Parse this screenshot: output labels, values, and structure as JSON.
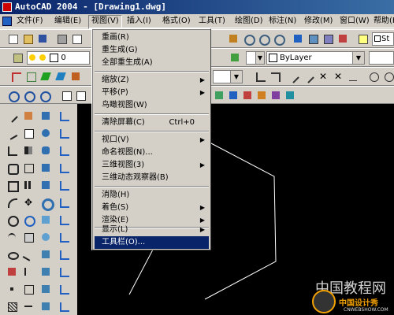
{
  "window": {
    "title": "AutoCAD 2004 - [Drawing1.dwg]"
  },
  "menubar": {
    "items": [
      {
        "label": "文件(F)"
      },
      {
        "label": "编辑(E)"
      },
      {
        "label": "视图(V)"
      },
      {
        "label": "插入(I)"
      },
      {
        "label": "格式(O)"
      },
      {
        "label": "工具(T)"
      },
      {
        "label": "绘图(D)"
      },
      {
        "label": "标注(N)"
      },
      {
        "label": "修改(M)"
      },
      {
        "label": "窗口(W)"
      },
      {
        "label": "帮助(H)"
      }
    ],
    "active_index": 2
  },
  "view_menu": {
    "items": [
      {
        "label": "重画(R)",
        "shortcut": "",
        "submenu": false
      },
      {
        "label": "重生成(G)",
        "shortcut": "",
        "submenu": false
      },
      {
        "label": "全部重生成(A)",
        "shortcut": "",
        "submenu": false
      },
      {
        "label": "缩放(Z)",
        "shortcut": "",
        "submenu": true
      },
      {
        "label": "平移(P)",
        "shortcut": "",
        "submenu": true
      },
      {
        "label": "鸟瞰视图(W)",
        "shortcut": "",
        "submenu": false
      },
      {
        "label": "清除屏幕(C)",
        "shortcut": "Ctrl+0",
        "submenu": false
      },
      {
        "label": "视口(V)",
        "shortcut": "",
        "submenu": true
      },
      {
        "label": "命名视图(N)...",
        "shortcut": "",
        "submenu": false
      },
      {
        "label": "三维视图(3)",
        "shortcut": "",
        "submenu": true
      },
      {
        "label": "三维动态观察器(B)",
        "shortcut": "",
        "submenu": false
      },
      {
        "label": "消隐(H)",
        "shortcut": "",
        "submenu": false
      },
      {
        "label": "着色(S)",
        "shortcut": "",
        "submenu": true
      },
      {
        "label": "渲染(E)",
        "shortcut": "",
        "submenu": true
      },
      {
        "label": "显示(L)",
        "shortcut": "",
        "submenu": true
      },
      {
        "label": "工具栏(O)...",
        "shortcut": "",
        "submenu": false
      }
    ],
    "highlighted": "工具栏(O)..."
  },
  "toolbar": {
    "layer_value": "0",
    "linetype_value": "ByLayer",
    "style_value": "St"
  },
  "watermark": {
    "text": "中国教程网",
    "badge": "中国设计秀",
    "sub": "CNWEBSHOW.COM"
  },
  "colors": {
    "titlebar_start": "#0a246a",
    "menu_highlight": "#0a246a",
    "canvas": "#000000",
    "chrome": "#d4d0c8"
  }
}
